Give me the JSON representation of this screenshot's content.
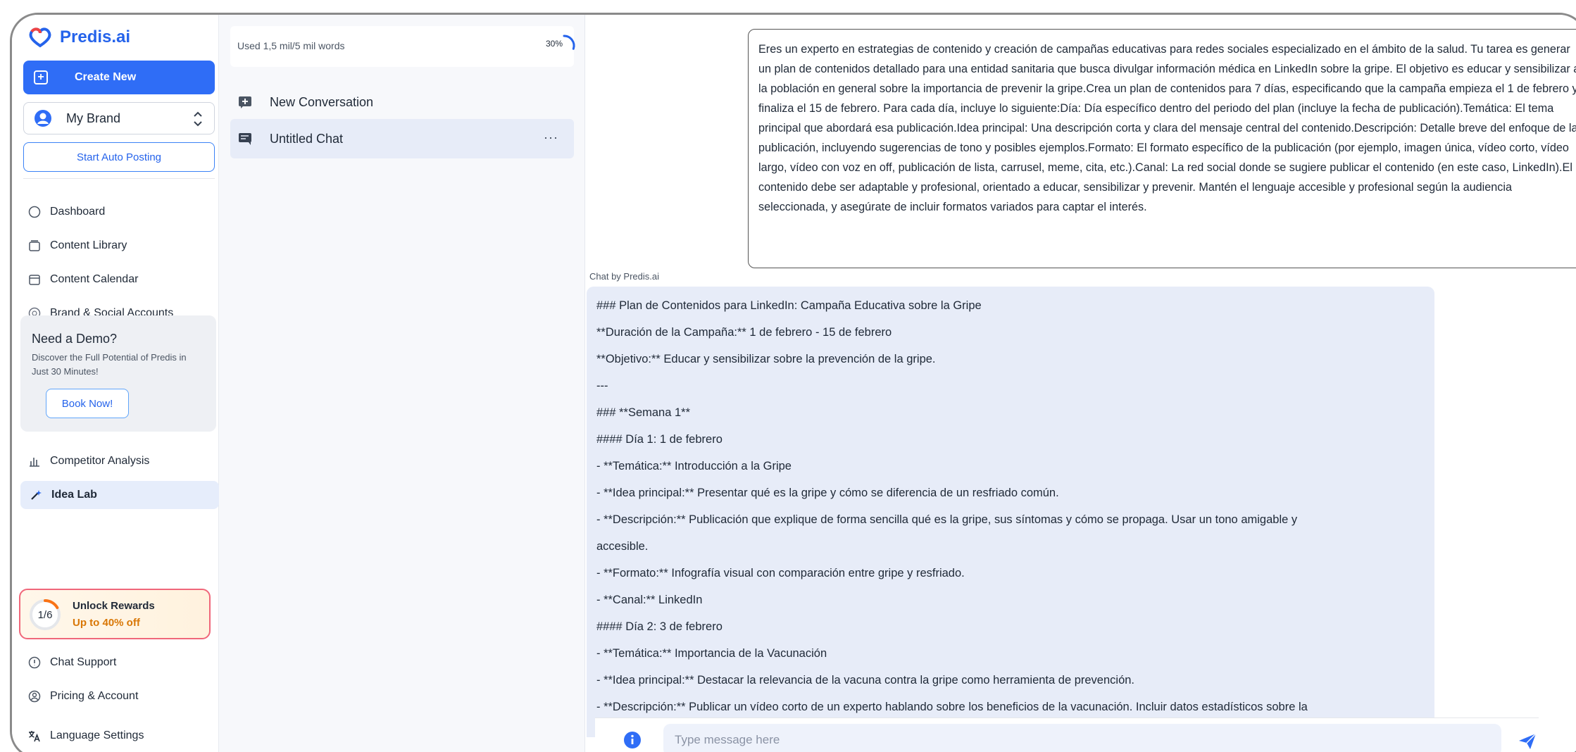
{
  "app": {
    "name": "Predis.ai",
    "brand_color": "#2563eb",
    "accent_color": "#2f6df6"
  },
  "sidebar": {
    "create_label": "Create New",
    "brand_label": "My Brand",
    "auto_posting_label": "Start Auto Posting",
    "nav": [
      {
        "label": "Dashboard",
        "icon": "home-icon"
      },
      {
        "label": "Content Library",
        "icon": "library-icon"
      },
      {
        "label": "Content Calendar",
        "icon": "calendar-icon"
      },
      {
        "label": "Brand & Social Accounts",
        "icon": "globe-icon"
      }
    ],
    "demo": {
      "title": "Need a Demo?",
      "desc": "Discover the Full Potential of Predis in Just 30 Minutes!",
      "button": "Book Now!"
    },
    "nav2": [
      {
        "label": "Competitor Analysis",
        "icon": "chart-icon"
      },
      {
        "label": "Idea Lab",
        "icon": "wand-icon",
        "active": true
      }
    ],
    "rewards": {
      "progress": "1/6",
      "progress_fraction": 0.1667,
      "title": "Unlock Rewards",
      "subtitle": "Up to 40% off"
    },
    "footer": [
      {
        "label": "Chat Support",
        "icon": "help-icon"
      },
      {
        "label": "Pricing & Account",
        "icon": "account-icon"
      },
      {
        "label": "Language Settings",
        "icon": "translate-icon"
      }
    ]
  },
  "conversations": {
    "usage_text": "Used 1,5 mil/5 mil words",
    "usage_percent": "30%",
    "usage_fraction": 0.3,
    "new_label": "New Conversation",
    "items": [
      {
        "label": "Untitled Chat",
        "more": "···"
      }
    ]
  },
  "chat": {
    "prompt": "Eres un experto en estrategias de contenido y creación de campañas educativas para redes sociales especializado en el ámbito de la salud. Tu tarea es generar un plan de contenidos detallado para una entidad sanitaria que busca divulgar información médica en LinkedIn sobre la gripe. El objetivo es educar y sensibilizar a la población en general sobre la importancia de prevenir la gripe.Crea un plan de contenidos para 7 días, especificando que la campaña empieza el 1 de febrero y finaliza el 15 de febrero. Para cada día, incluye lo siguiente:Día: Día específico dentro del periodo del plan (incluye la fecha de publicación).Temática: El tema principal que abordará esa publicación.Idea principal: Una descripción corta y clara del mensaje central del contenido.Descripción: Detalle breve del enfoque de la publicación, incluyendo sugerencias de tono y posibles ejemplos.Formato: El formato específico de la publicación (por ejemplo, imagen única, vídeo corto, vídeo largo, vídeo con voz en off, publicación de lista, carrusel, meme, cita, etc.).Canal: La red social donde se sugiere publicar el contenido (en este caso, LinkedIn).El contenido debe ser adaptable y profesional, orientado a educar, sensibilizar y prevenir. Mantén el lenguaje accesible y profesional según la audiencia seleccionada, y asegúrate de incluir formatos variados para captar el interés.",
    "chat_by": "Chat by Predis.ai",
    "reply_lines": [
      "### Plan de Contenidos para LinkedIn: Campaña Educativa sobre la Gripe",
      "**Duración de la Campaña:** 1 de febrero - 15 de febrero",
      "**Objetivo:** Educar y sensibilizar sobre la prevención de la gripe.",
      "---",
      "### **Semana 1**",
      "#### Día 1: 1 de febrero",
      "- **Temática:** Introducción a la Gripe",
      "- **Idea principal:** Presentar qué es la gripe y cómo se diferencia de un resfriado común.",
      "- **Descripción:** Publicación que explique de forma sencilla qué es la gripe, sus síntomas y cómo se propaga. Usar un tono amigable y",
      "accesible.",
      "- **Formato:** Infografía visual con comparación entre gripe y resfriado.",
      "- **Canal:** LinkedIn",
      "#### Día 2: 3 de febrero",
      "- **Temática:** Importancia de la Vacunación",
      "- **Idea principal:** Destacar la relevancia de la vacuna contra la gripe como herramienta de prevención.",
      "- **Descripción:** Publicar un vídeo corto de un experto hablando sobre los beneficios de la vacunación. Incluir datos estadísticos sobre la"
    ],
    "input_placeholder": "Type message here",
    "input_value": ""
  }
}
